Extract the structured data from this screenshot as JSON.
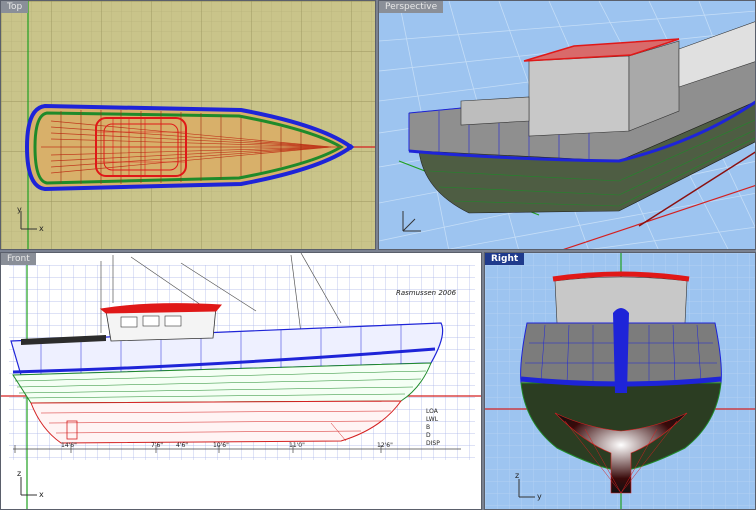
{
  "viewports": {
    "top": {
      "title": "Top"
    },
    "persp": {
      "title": "Perspective"
    },
    "front": {
      "title": "Front"
    },
    "right": {
      "title": "Right"
    }
  },
  "axes": {
    "x": "x",
    "y": "y",
    "z": "z"
  },
  "drawing_notes": {
    "signature": "Rasmussen 2006",
    "dims": [
      "14'6\"",
      "7'6\"",
      "4'6\"",
      "10'6\"",
      "11'0\"",
      "12'6\""
    ],
    "specs": [
      "LOA",
      "LWL",
      "B",
      "D",
      "DISP"
    ]
  },
  "colors": {
    "top_bg": "#c9c48a",
    "persp_bg": "#9dc4f0",
    "right_bg": "#9dc4f0",
    "front_bg": "#ffffff",
    "gunwale": "#1e24d8",
    "hull_green": "#1f8a2a",
    "cabin_red": "#e01818",
    "x_axis": "#d42020",
    "y_axis": "#20a020"
  }
}
